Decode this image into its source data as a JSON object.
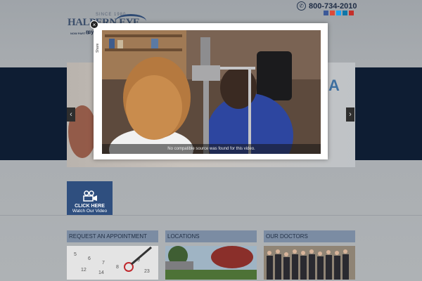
{
  "header": {
    "phone": "800-734-2010",
    "phone_icon": "phone-icon",
    "social_colors": [
      "#3b5998",
      "#dd4b39",
      "#1da1f2",
      "#0e76a8",
      "#c4302b"
    ],
    "logo": {
      "since": "SINCE 1980",
      "name": "HALPERN EYE",
      "sub": "NOW PART OF",
      "brand": "my"
    }
  },
  "hero": {
    "letter": "A",
    "prev_label": "‹",
    "next_label": "›"
  },
  "video_button": {
    "line1": "CLICK HERE",
    "line2": "Watch Our Video",
    "icon": "video-camera-icon"
  },
  "modal": {
    "close_label": "×",
    "share_label": "Share",
    "message": "No compatible source was found for this video."
  },
  "cards": [
    {
      "title": "REQUEST AN APPOINTMENT"
    },
    {
      "title": "LOCATIONS"
    },
    {
      "title": "OUR DOCTORS"
    }
  ],
  "colors": {
    "accent": "#2f4f7f",
    "navy": "#0e1d33",
    "card_head": "#7b8ca3"
  }
}
